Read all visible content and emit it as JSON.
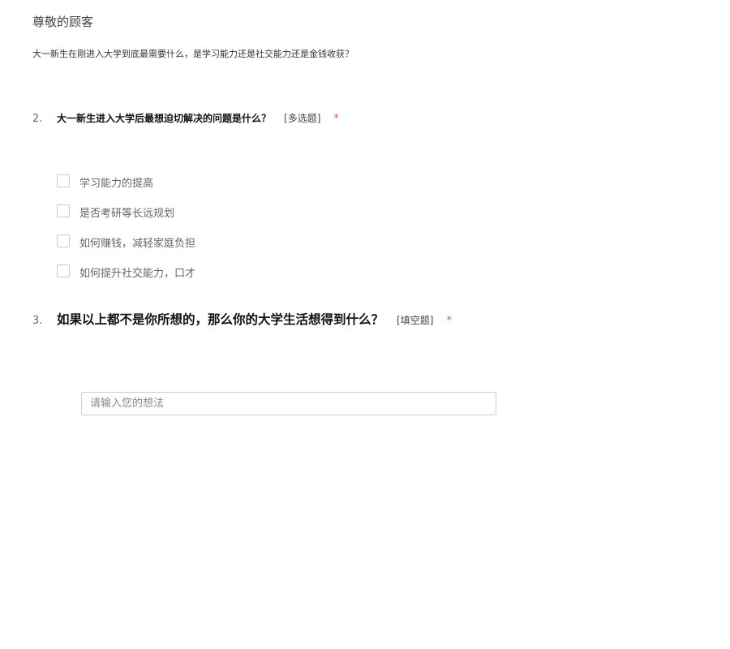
{
  "header": {
    "greeting": "尊敬的顾客",
    "intro": "大一新生在刚进入大学到底最需要什么，是学习能力还是社交能力还是金钱收获？"
  },
  "questions": [
    {
      "number": "2.",
      "title": "大一新生进入大学后最想迫切解决的问题是什么？",
      "type": "[多选题]",
      "required_mark": "*",
      "options": [
        {
          "label": "学习能力的提高",
          "checked": false
        },
        {
          "label": "是否考研等长远规划",
          "checked": false
        },
        {
          "label": "如何赚钱，减轻家庭负担",
          "checked": false
        },
        {
          "label": "如何提升社交能力，口才",
          "checked": false
        }
      ]
    },
    {
      "number": "3.",
      "title": "如果以上都不是你所想的，那么你的大学生活想得到什么？",
      "type": "[填空题]",
      "required_mark": "*",
      "input": {
        "value": "",
        "placeholder": "请输入您的想法"
      }
    }
  ],
  "colors": {
    "required": "#e55b5b",
    "border": "#cccccc",
    "option_text": "#666666"
  }
}
